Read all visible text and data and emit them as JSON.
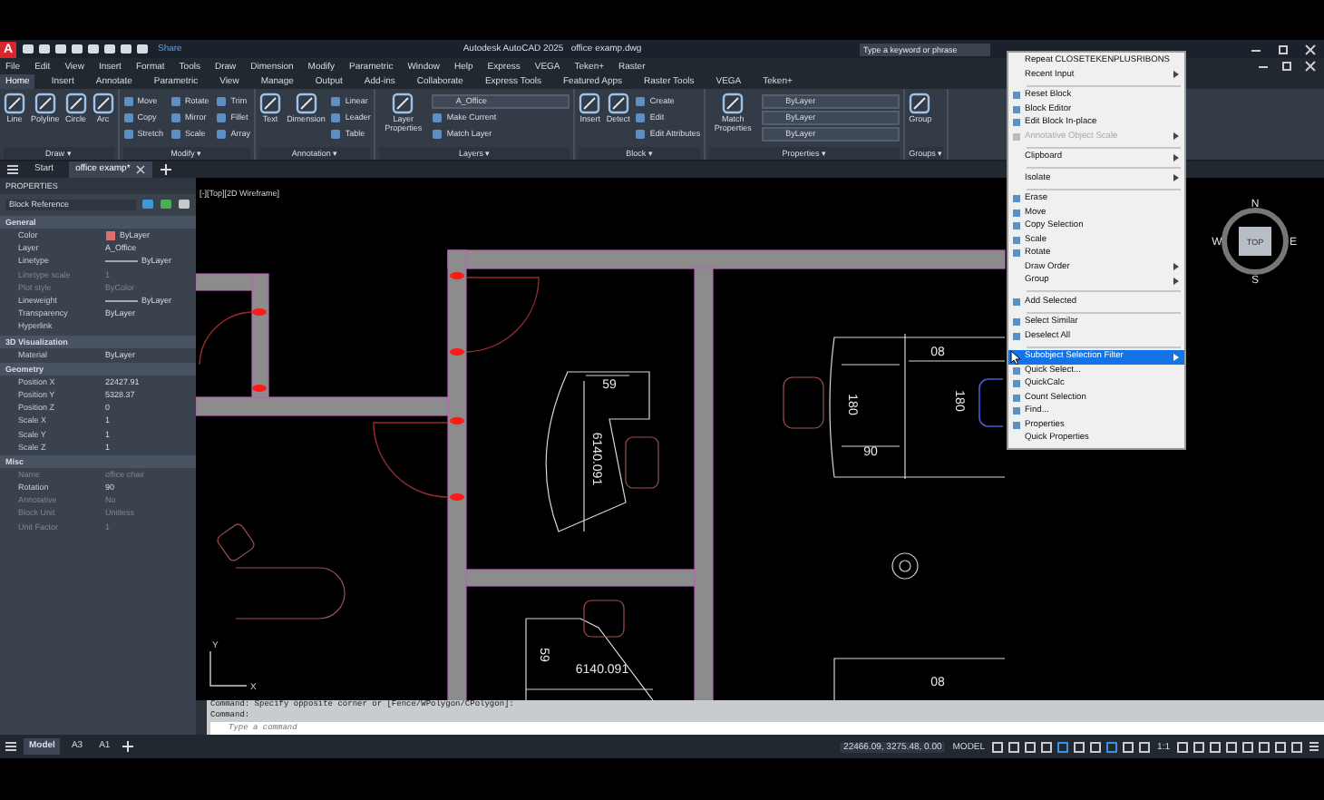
{
  "title_bar": {
    "logo": "A",
    "share": "Share",
    "title": "Autodesk AutoCAD 2025   office examp.dwg",
    "search": {
      "placeholder": "Type a keyword or phrase"
    }
  },
  "menu_bar": [
    "File",
    "Edit",
    "View",
    "Insert",
    "Format",
    "Tools",
    "Draw",
    "Dimension",
    "Modify",
    "Parametric",
    "Window",
    "Help",
    "Express",
    "VEGA",
    "Teken+",
    "Raster"
  ],
  "ribbon_tabs": [
    {
      "label": "Home",
      "selected": true
    },
    {
      "label": "Insert",
      "selected": false
    },
    {
      "label": "Annotate",
      "selected": false
    },
    {
      "label": "Parametric",
      "selected": false
    },
    {
      "label": "View",
      "selected": false
    },
    {
      "label": "Manage",
      "selected": false
    },
    {
      "label": "Output",
      "selected": false
    },
    {
      "label": "Add-ins",
      "selected": false
    },
    {
      "label": "Collaborate",
      "selected": false
    },
    {
      "label": "Express Tools",
      "selected": false
    },
    {
      "label": "Featured Apps",
      "selected": false
    },
    {
      "label": "Raster Tools",
      "selected": false
    },
    {
      "label": "VEGA",
      "selected": false
    },
    {
      "label": "Teken+",
      "selected": false
    }
  ],
  "ribbon_panels": [
    {
      "title": "Draw ▾",
      "tools": [
        {
          "kind": "large",
          "label": "Line"
        },
        {
          "kind": "large",
          "label": "Polyline"
        },
        {
          "kind": "large",
          "label": "Circle"
        },
        {
          "kind": "large",
          "label": "Arc"
        }
      ]
    },
    {
      "title": "Modify ▾",
      "tools": [
        {
          "kind": "small",
          "label": "Move"
        },
        {
          "kind": "small",
          "label": "Copy"
        },
        {
          "kind": "small",
          "label": "Stretch"
        },
        {
          "kind": "small",
          "label": "Rotate"
        },
        {
          "kind": "small",
          "label": "Mirror"
        },
        {
          "kind": "small",
          "label": "Scale"
        },
        {
          "kind": "small",
          "label": "Trim"
        },
        {
          "kind": "small",
          "label": "Fillet"
        },
        {
          "kind": "small",
          "label": "Array"
        }
      ]
    },
    {
      "title": "Annotation ▾",
      "tools": [
        {
          "kind": "large",
          "label": "Text"
        },
        {
          "kind": "large",
          "label": "Dimension"
        },
        {
          "kind": "small",
          "label": "Linear"
        },
        {
          "kind": "small",
          "label": "Leader"
        },
        {
          "kind": "small",
          "label": "Table"
        }
      ]
    },
    {
      "title": "Layers ▾",
      "tools": [
        {
          "kind": "large",
          "label": "Layer Properties"
        },
        {
          "kind": "dropdown",
          "label": "A_Office"
        },
        {
          "kind": "small",
          "label": "Make Current"
        },
        {
          "kind": "small",
          "label": "Match Layer"
        }
      ]
    },
    {
      "title": "Block ▾",
      "tools": [
        {
          "kind": "large",
          "label": "Insert"
        },
        {
          "kind": "large",
          "label": "Detect"
        },
        {
          "kind": "small",
          "label": "Create"
        },
        {
          "kind": "small",
          "label": "Edit"
        },
        {
          "kind": "small",
          "label": "Edit Attributes"
        }
      ]
    },
    {
      "title": "Properties ▾",
      "tools": [
        {
          "kind": "large",
          "label": "Match Properties"
        },
        {
          "kind": "dropdown",
          "label": "ByLayer"
        },
        {
          "kind": "dropdown",
          "label": "ByLayer"
        },
        {
          "kind": "dropdown",
          "label": "ByLayer"
        }
      ]
    },
    {
      "title": "Groups ▾",
      "tools": [
        {
          "kind": "large",
          "label": "Group"
        }
      ]
    }
  ],
  "file_tabs": [
    {
      "label": "Start",
      "selected": false
    },
    {
      "label": "office examp*",
      "selected": true
    }
  ],
  "properties": {
    "title": "PROPERTIES",
    "object": "Block Reference",
    "sections": [
      {
        "title": "General",
        "rows": [
          {
            "kind": "color",
            "label": "Color",
            "value": "ByLayer",
            "disabled": false
          },
          {
            "kind": "text",
            "label": "Layer",
            "value": "A_Office",
            "disabled": false
          },
          {
            "kind": "line",
            "label": "Linetype",
            "value": "ByLayer",
            "disabled": false
          },
          {
            "kind": "text",
            "label": "Linetype scale",
            "value": "1",
            "disabled": true
          },
          {
            "kind": "text",
            "label": "Plot style",
            "value": "ByColor",
            "disabled": true
          },
          {
            "kind": "line",
            "label": "Lineweight",
            "value": "ByLayer",
            "disabled": false
          },
          {
            "kind": "text",
            "label": "Transparency",
            "value": "ByLayer",
            "disabled": false
          },
          {
            "kind": "text",
            "label": "Hyperlink",
            "disabled": false
          }
        ]
      },
      {
        "title": "3D Visualization",
        "rows": [
          {
            "kind": "text",
            "label": "Material",
            "value": "ByLayer",
            "disabled": false
          }
        ]
      },
      {
        "title": "Geometry",
        "rows": [
          {
            "kind": "text",
            "label": "Position X",
            "value": "22427.91",
            "disabled": false
          },
          {
            "kind": "text",
            "label": "Position Y",
            "value": "5328.37",
            "disabled": false
          },
          {
            "kind": "text",
            "label": "Position Z",
            "value": "0",
            "disabled": false
          },
          {
            "kind": "text",
            "label": "Scale X",
            "value": "1",
            "disabled": false
          },
          {
            "kind": "text",
            "label": "Scale Y",
            "value": "1",
            "disabled": false
          },
          {
            "kind": "text",
            "label": "Scale Z",
            "value": "1",
            "disabled": false
          }
        ]
      },
      {
        "title": "Misc",
        "rows": [
          {
            "kind": "text",
            "label": "Name",
            "value": "office chair",
            "disabled": true
          },
          {
            "kind": "text",
            "label": "Rotation",
            "value": "90",
            "disabled": false
          },
          {
            "kind": "text",
            "label": "Annotative",
            "value": "No",
            "disabled": true
          },
          {
            "kind": "text",
            "label": "Block Unit",
            "value": "Unitless",
            "disabled": true
          },
          {
            "kind": "text",
            "label": "Unit Factor",
            "value": "1",
            "disabled": true
          }
        ]
      }
    ]
  },
  "viewport": {
    "label": "[-][Top][2D Wireframe]",
    "dimension_labels": [
      "59",
      "6140.091",
      "08",
      "180",
      "180",
      "90",
      "59",
      "6140.091",
      "08"
    ],
    "compass": {
      "north": "N",
      "west": "W",
      "east": "E",
      "south": "S",
      "cube": "TOP"
    },
    "ucs": {
      "x": "X",
      "y": "Y"
    }
  },
  "context_menu": [
    {
      "kind": "item",
      "label": "Repeat CLOSETEKENPLUSRIBONS",
      "icon": false,
      "submenu": false,
      "disabled": false,
      "selected": false
    },
    {
      "kind": "item",
      "label": "Recent Input",
      "icon": false,
      "submenu": true,
      "disabled": false,
      "selected": false
    },
    {
      "kind": "separator"
    },
    {
      "kind": "item",
      "label": "Reset Block",
      "icon": true,
      "submenu": false,
      "disabled": false,
      "selected": false
    },
    {
      "kind": "item",
      "label": "Block Editor",
      "icon": true,
      "submenu": false,
      "disabled": false,
      "selected": false
    },
    {
      "kind": "item",
      "label": "Edit Block In-place",
      "icon": true,
      "submenu": false,
      "disabled": false,
      "selected": false
    },
    {
      "kind": "item",
      "label": "Annotative Object Scale",
      "icon": true,
      "submenu": true,
      "disabled": true,
      "selected": false
    },
    {
      "kind": "separator"
    },
    {
      "kind": "item",
      "label": "Clipboard",
      "icon": false,
      "submenu": true,
      "disabled": false,
      "selected": false
    },
    {
      "kind": "separator"
    },
    {
      "kind": "item",
      "label": "Isolate",
      "icon": false,
      "submenu": true,
      "disabled": false,
      "selected": false
    },
    {
      "kind": "separator"
    },
    {
      "kind": "item",
      "label": "Erase",
      "icon": true,
      "submenu": false,
      "disabled": false,
      "selected": false
    },
    {
      "kind": "item",
      "label": "Move",
      "icon": true,
      "submenu": false,
      "disabled": false,
      "selected": false
    },
    {
      "kind": "item",
      "label": "Copy Selection",
      "icon": true,
      "submenu": false,
      "disabled": false,
      "selected": false
    },
    {
      "kind": "item",
      "label": "Scale",
      "icon": true,
      "submenu": false,
      "disabled": false,
      "selected": false
    },
    {
      "kind": "item",
      "label": "Rotate",
      "icon": true,
      "submenu": false,
      "disabled": false,
      "selected": false
    },
    {
      "kind": "item",
      "label": "Draw Order",
      "icon": false,
      "submenu": true,
      "disabled": false,
      "selected": false
    },
    {
      "kind": "item",
      "label": "Group",
      "icon": false,
      "submenu": true,
      "disabled": false,
      "selected": false
    },
    {
      "kind": "separator"
    },
    {
      "kind": "item",
      "label": "Add Selected",
      "icon": true,
      "submenu": false,
      "disabled": false,
      "selected": false
    },
    {
      "kind": "separator"
    },
    {
      "kind": "item",
      "label": "Select Similar",
      "icon": true,
      "submenu": false,
      "disabled": false,
      "selected": false
    },
    {
      "kind": "item",
      "label": "Deselect All",
      "icon": true,
      "submenu": false,
      "disabled": false,
      "selected": false
    },
    {
      "kind": "separator"
    },
    {
      "kind": "item",
      "label": "Subobject Selection Filter",
      "icon": false,
      "submenu": true,
      "disabled": false,
      "selected": true
    },
    {
      "kind": "item",
      "label": "Quick Select...",
      "icon": true,
      "submenu": false,
      "disabled": false,
      "selected": false
    },
    {
      "kind": "item",
      "label": "QuickCalc",
      "icon": true,
      "submenu": false,
      "disabled": false,
      "selected": false
    },
    {
      "kind": "item",
      "label": "Count Selection",
      "icon": true,
      "submenu": false,
      "disabled": false,
      "selected": false
    },
    {
      "kind": "item",
      "label": "Find...",
      "icon": true,
      "submenu": false,
      "disabled": false,
      "selected": false
    },
    {
      "kind": "item",
      "label": "Properties",
      "icon": true,
      "submenu": false,
      "disabled": false,
      "selected": false
    },
    {
      "kind": "item",
      "label": "Quick Properties",
      "icon": false,
      "submenu": false,
      "disabled": false,
      "selected": false
    }
  ],
  "command_line": {
    "history": [
      "Command: Specify opposite corner or [Fence/WPolygon/CPolygon]:",
      "Command:"
    ],
    "input": {
      "placeholder": "Type a command"
    }
  },
  "status_bar": {
    "layout_tabs": [
      {
        "label": "Model",
        "selected": true
      },
      {
        "label": "A3",
        "selected": false
      },
      {
        "label": "A1",
        "selected": false
      }
    ],
    "coordinates": "22466.09, 3275.48, 0.00",
    "space": "MODEL",
    "scale": "1:1"
  }
}
